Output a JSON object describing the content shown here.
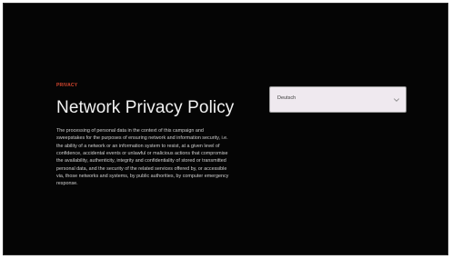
{
  "colors": {
    "background": "#050505",
    "accent": "#d7472f",
    "title": "#f2f2f2",
    "body": "#cfcfcf",
    "select_background": "#efe9ef"
  },
  "policy": {
    "eyebrow": "PRIVACY",
    "title": "Network Privacy Policy",
    "paragraph": "The processing of personal data in the context of this campaign and sweepstakes for the purposes of ensuring network and information security, i.e. the ability of a network or an information system to resist, at a given level of confidence, accidental events or unlawful or malicious actions that compromise the availability, authenticity, integrity and confidentiality of stored or transmitted personal data, and the security of the related services offered by, or accessible via, those networks and systems, by public authorities, by computer emergency response."
  },
  "language_select": {
    "value": "Deutsch",
    "icon": "chevron-down-icon"
  }
}
